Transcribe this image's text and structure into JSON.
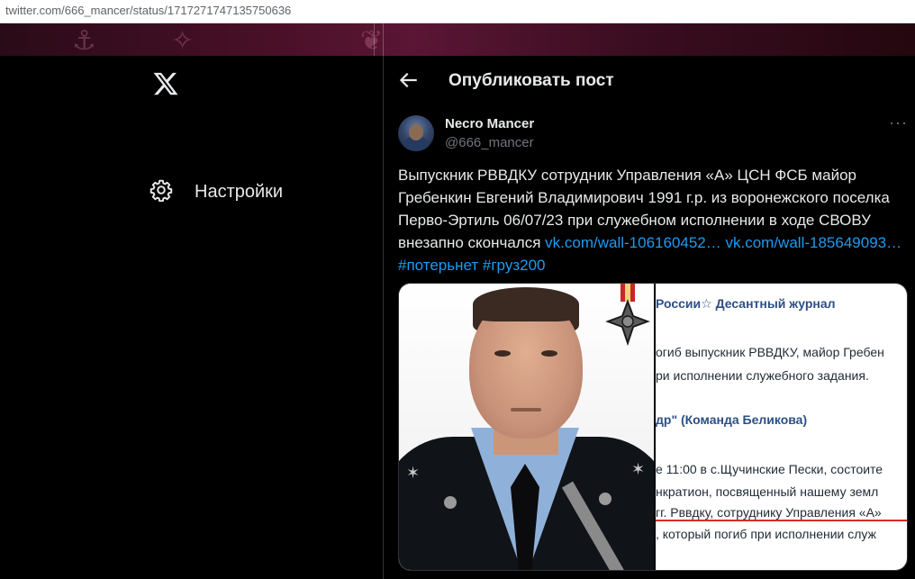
{
  "browser": {
    "url": "twitter.com/666_mancer/status/1717271747135750636"
  },
  "sidebar": {
    "logo_icon": "x-logo-icon",
    "items": [
      {
        "label": "Настройки",
        "icon": "gear-icon"
      }
    ]
  },
  "header": {
    "title": "Опубликовать пост",
    "back_icon": "arrow-left-icon"
  },
  "tweet": {
    "author_name": "Necro Mancer",
    "author_handle": "@666_mancer",
    "more_label": "···",
    "text_plain": "Выпускник РВВДКУ сотрудник Управления «А» ЦСН ФСБ майор Гребенкин Евгений Владимирович 1991 г.р. из воронежского поселка Перво-Эртиль 06/07/23 при служебном исполнении в ходе СВОВУ внезапно скончался ",
    "link1": "vk.com/wall-106160452…",
    "link2": "vk.com/wall-185649093…",
    "hashtag1": "#потерьнет",
    "hashtag2": "#груз200"
  },
  "media": {
    "clipping_lines": [
      {
        "text": "России☆ Десантный журнал",
        "bold": true
      },
      {
        "text": "огиб выпускник РВВДКУ, майор Гребен",
        "bold": false
      },
      {
        "text": "ри исполнении служебного задания.",
        "bold": false
      },
      {
        "text": "др\" (Команда Беликова)",
        "bold": true
      },
      {
        "text": "е 11:00 в с.Щучинские Пески, состоите",
        "bold": false
      },
      {
        "text": "нкратион, посвященный нашему земл",
        "bold": false
      },
      {
        "text": "гг. Рввдку, сотруднику Управления «А»",
        "bold": false
      },
      {
        "text": ", который погиб при исполнении служ",
        "bold": false
      }
    ]
  },
  "colors": {
    "accent": "#1d9bf0",
    "background": "#000000",
    "text": "#e7e9ea",
    "muted": "#71767b",
    "border": "#2f3336"
  }
}
